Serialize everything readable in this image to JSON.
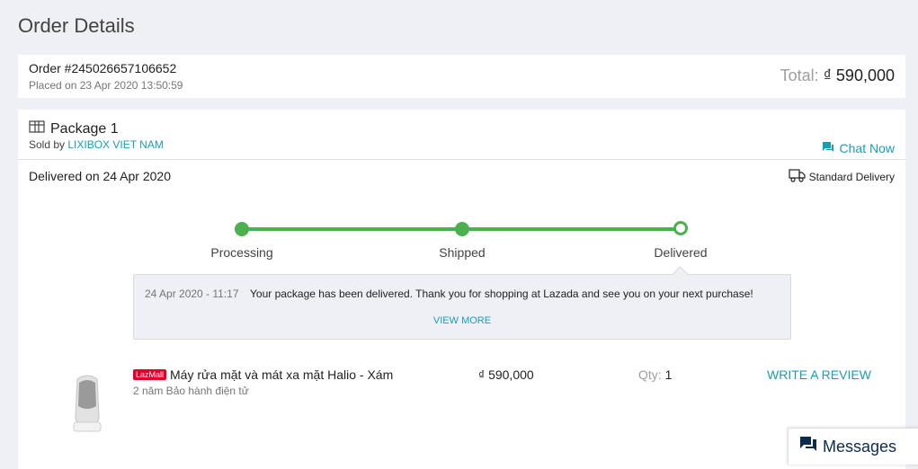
{
  "page_title": "Order Details",
  "order": {
    "number": "Order #245026657106652",
    "placed_on": "Placed on 23 Apr 2020 13:50:59",
    "total_label": "Total:",
    "total_value": "₫ 590,000"
  },
  "package": {
    "title": "Package 1",
    "sold_by_label": "Sold by",
    "seller": "LIXIBOX VIET NAM",
    "chat_now": "Chat Now",
    "delivered_on": "Delivered on 24 Apr 2020",
    "delivery_type": "Standard Delivery",
    "steps": [
      "Processing",
      "Shipped",
      "Delivered"
    ],
    "status_time": "24 Apr 2020 - 11:17",
    "status_message": "Your package has been delivered. Thank you for shopping at Lazada and see you on your next purchase!",
    "view_more": "VIEW MORE"
  },
  "product": {
    "badge": "LazMall",
    "name": "Máy rửa mặt và mát xa mặt Halio - Xám",
    "warranty": "2 năm Bảo hành điện tử",
    "price": "₫ 590,000",
    "qty_label": "Qty:",
    "qty": "1",
    "review": "WRITE A REVIEW"
  },
  "messages": {
    "label": "Messages"
  },
  "colors": {
    "accent": "#1a9cb7",
    "progress": "#4caf50",
    "badge": "#e0002a"
  }
}
